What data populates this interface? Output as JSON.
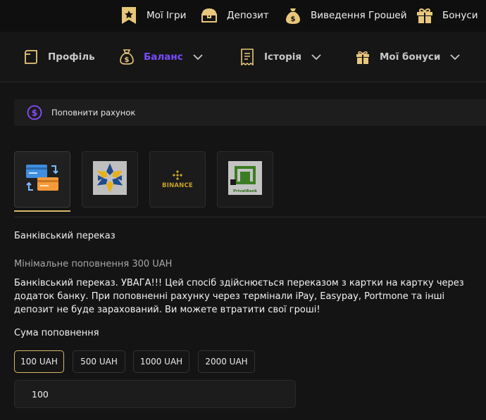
{
  "topnav": {
    "items": [
      {
        "label": "Мої Ігри",
        "icon": "star-bookmark-icon"
      },
      {
        "label": "Депозит",
        "icon": "treasure-chest-icon"
      },
      {
        "label": "Виведення Грошей",
        "icon": "money-bag-icon"
      },
      {
        "label": "Бонуси",
        "icon": "gift-icon"
      }
    ]
  },
  "tabs": {
    "items": [
      {
        "label": "Профіль",
        "icon": "profile-card-icon"
      },
      {
        "label": "Баланс",
        "icon": "money-bag-icon",
        "active": true
      },
      {
        "label": "Історія",
        "icon": "receipt-icon"
      },
      {
        "label": "Мої бонуси",
        "icon": "gift-icon"
      }
    ]
  },
  "banner": {
    "label": "Поповнити рахунок",
    "icon": "dollar-circle-icon"
  },
  "methods": [
    {
      "name": "bank-transfer",
      "icon": "credit-cards-exchange-icon",
      "active": true
    },
    {
      "name": "hexagon-bank",
      "icon": "star-hexagon-logo-icon"
    },
    {
      "name": "binance",
      "label": "BINANCE",
      "icon": "binance-logo-icon"
    },
    {
      "name": "privatbank",
      "label": "PrivatBank",
      "icon": "privatbank-logo-icon"
    }
  ],
  "section": {
    "title": "Банківський переказ",
    "min": "Мінімальне поповнення 300 UAH",
    "warning": "Банківський переказ. УВАГА!!! Цей спосіб здійснюється переказом з картки на картку через додаток банку. При поповненні рахунку через термінали iPay, Easypay, Portmone та інші депозит не буде зарахований. Ви можете втратити свої гроші!",
    "amount_label": "Сума поповнення"
  },
  "amounts": [
    "100 UAH",
    "500 UAH",
    "1000 UAH",
    "2000 UAH"
  ],
  "selected_amount": "100 UAH",
  "amount_input": {
    "value": "100"
  },
  "colors": {
    "accent": "#7a4cff",
    "gold": "#d8b76a",
    "background": "#141414"
  }
}
